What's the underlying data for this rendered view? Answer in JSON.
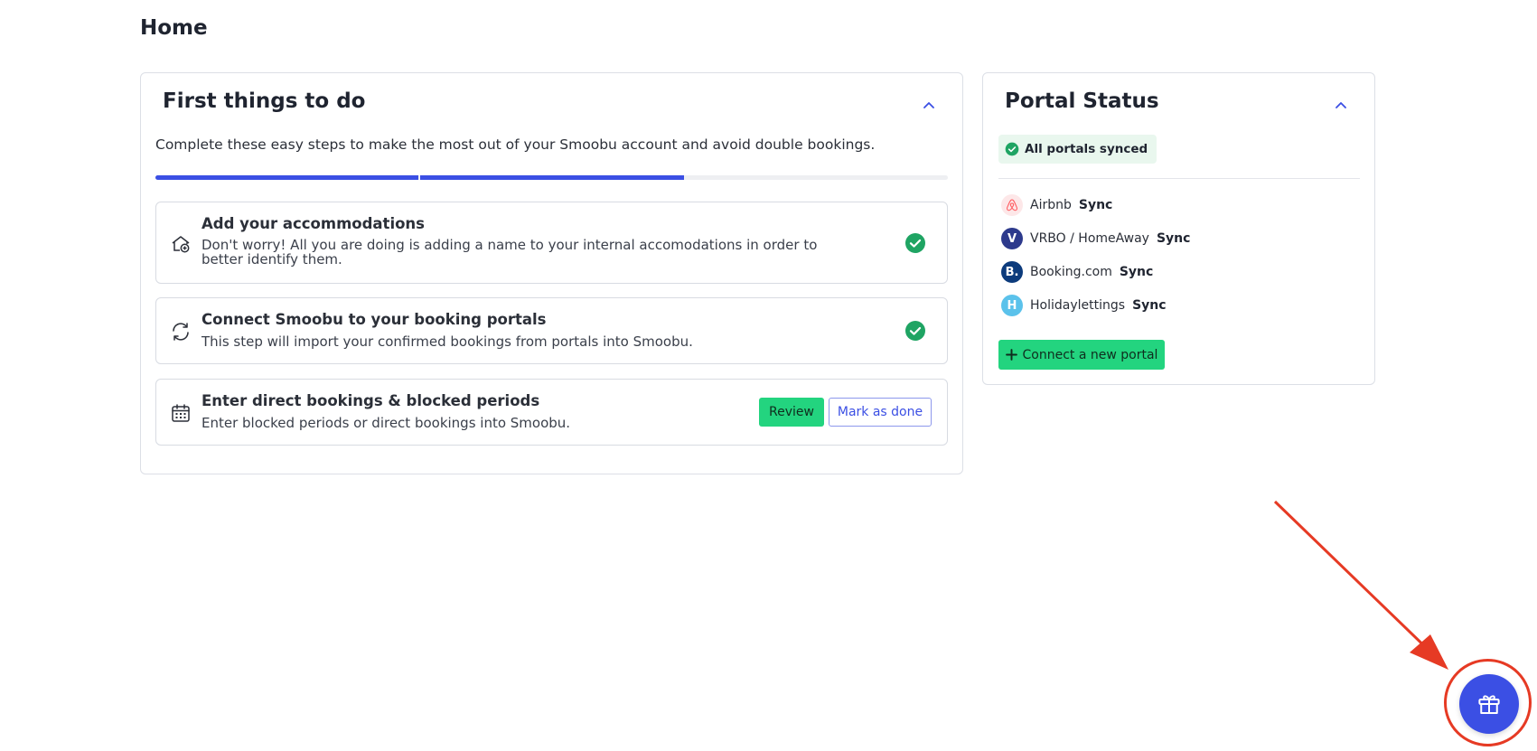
{
  "page": {
    "title": "Home"
  },
  "first_things": {
    "title": "First things to do",
    "subtitle": "Complete these easy steps to make the most out of your Smoobu account and avoid double bookings.",
    "progress_completed": 2,
    "progress_total": 3,
    "steps": [
      {
        "icon": "house-add-icon",
        "title": "Add your accommodations",
        "description": "Don't worry! All you are doing is adding a name to your internal accomodations in order to better identify them.",
        "status": "done"
      },
      {
        "icon": "sync-icon",
        "title": "Connect Smoobu to your booking portals",
        "description": "This step will import your confirmed bookings from portals into Smoobu.",
        "status": "done"
      },
      {
        "icon": "calendar-icon",
        "title": "Enter direct bookings & blocked periods",
        "description": "Enter blocked periods or direct bookings into Smoobu.",
        "status": "pending",
        "review_label": "Review",
        "mark_done_label": "Mark as done"
      }
    ]
  },
  "portal_status": {
    "title": "Portal Status",
    "badge": "All portals synced",
    "portals": [
      {
        "name": "Airbnb",
        "status": "Sync",
        "logo_letter": "",
        "logo_icon": "airbnb-logo-icon",
        "color": "#ff5a5f"
      },
      {
        "name": "VRBO / HomeAway",
        "status": "Sync",
        "logo_letter": "V",
        "logo_icon": "vrbo-logo-icon",
        "color": "#2d3a8c"
      },
      {
        "name": "Booking.com",
        "status": "Sync",
        "logo_letter": "B.",
        "logo_icon": "booking-logo-icon",
        "color": "#0c3b7c"
      },
      {
        "name": "Holidaylettings",
        "status": "Sync",
        "logo_letter": "H",
        "logo_icon": "holidaylettings-logo-icon",
        "color": "#5bc2eb"
      }
    ],
    "connect_label": "Connect a new portal"
  },
  "colors": {
    "accent": "#3b4fe4",
    "success": "#23d47f",
    "check": "#1fa463",
    "annotation": "#e63a24"
  },
  "fab": {
    "icon": "gift-icon"
  }
}
